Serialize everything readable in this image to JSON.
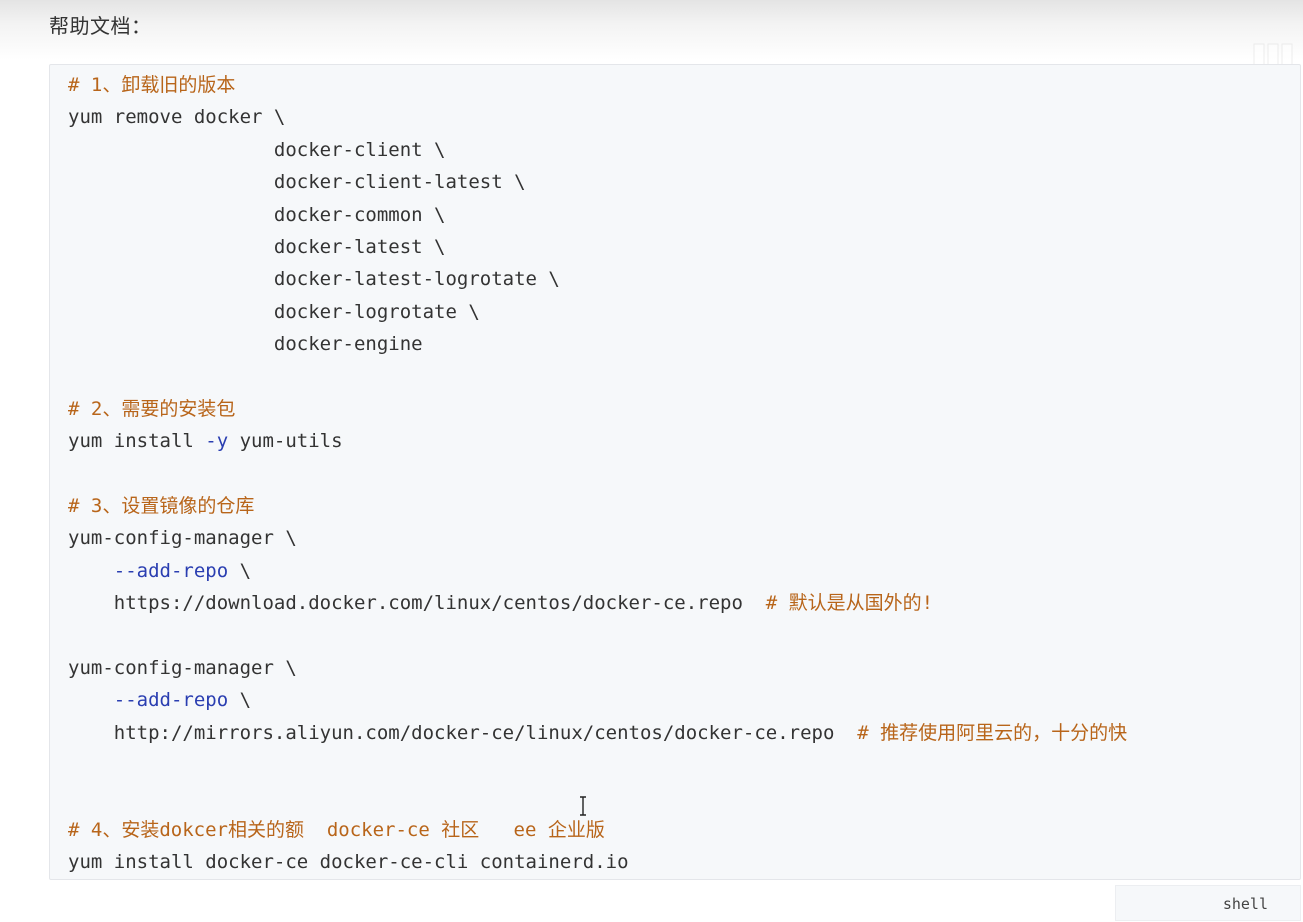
{
  "page": {
    "heading": "帮助文档："
  },
  "code_block": {
    "language": "shell",
    "lines": [
      [
        {
          "t": "comment",
          "v": "# 1、卸载旧的版本"
        }
      ],
      [
        {
          "t": "plain",
          "v": "yum remove docker \\"
        }
      ],
      [
        {
          "t": "plain",
          "v": "                  docker-client \\"
        }
      ],
      [
        {
          "t": "plain",
          "v": "                  docker-client-latest \\"
        }
      ],
      [
        {
          "t": "plain",
          "v": "                  docker-common \\"
        }
      ],
      [
        {
          "t": "plain",
          "v": "                  docker-latest \\"
        }
      ],
      [
        {
          "t": "plain",
          "v": "                  docker-latest-logrotate \\"
        }
      ],
      [
        {
          "t": "plain",
          "v": "                  docker-logrotate \\"
        }
      ],
      [
        {
          "t": "plain",
          "v": "                  docker-engine"
        }
      ],
      [
        {
          "t": "plain",
          "v": ""
        }
      ],
      [
        {
          "t": "comment",
          "v": "# 2、需要的安装包"
        }
      ],
      [
        {
          "t": "plain",
          "v": "yum install "
        },
        {
          "t": "flag",
          "v": "-y"
        },
        {
          "t": "plain",
          "v": " yum-utils"
        }
      ],
      [
        {
          "t": "plain",
          "v": ""
        }
      ],
      [
        {
          "t": "comment",
          "v": "# 3、设置镜像的仓库"
        }
      ],
      [
        {
          "t": "plain",
          "v": "yum-config-manager \\"
        }
      ],
      [
        {
          "t": "plain",
          "v": "    "
        },
        {
          "t": "flag",
          "v": "--add-repo"
        },
        {
          "t": "plain",
          "v": " \\"
        }
      ],
      [
        {
          "t": "plain",
          "v": "    https://download.docker.com/linux/centos/docker-ce.repo  "
        },
        {
          "t": "comment",
          "v": "# 默认是从国外的!"
        }
      ],
      [
        {
          "t": "plain",
          "v": ""
        }
      ],
      [
        {
          "t": "plain",
          "v": "yum-config-manager \\"
        }
      ],
      [
        {
          "t": "plain",
          "v": "    "
        },
        {
          "t": "flag",
          "v": "--add-repo"
        },
        {
          "t": "plain",
          "v": " \\"
        }
      ],
      [
        {
          "t": "plain",
          "v": "    http://mirrors.aliyun.com/docker-ce/linux/centos/docker-ce.repo  "
        },
        {
          "t": "comment",
          "v": "# 推荐使用阿里云的，十分的快"
        }
      ],
      [
        {
          "t": "plain",
          "v": ""
        }
      ],
      [
        {
          "t": "plain",
          "v": ""
        }
      ],
      [
        {
          "t": "comment",
          "v": "# 4、安装dokcer相关的额  docker-ce 社区   ee 企业版"
        }
      ],
      [
        {
          "t": "plain",
          "v": "yum install docker-ce docker-ce-cli containerd.io"
        }
      ]
    ]
  },
  "colors": {
    "comment": "#b8651a",
    "flag": "#2a3eb1",
    "plain": "#333333",
    "code_background": "#f6f8fa"
  },
  "icons": {
    "cursor": "text-cursor-icon"
  }
}
